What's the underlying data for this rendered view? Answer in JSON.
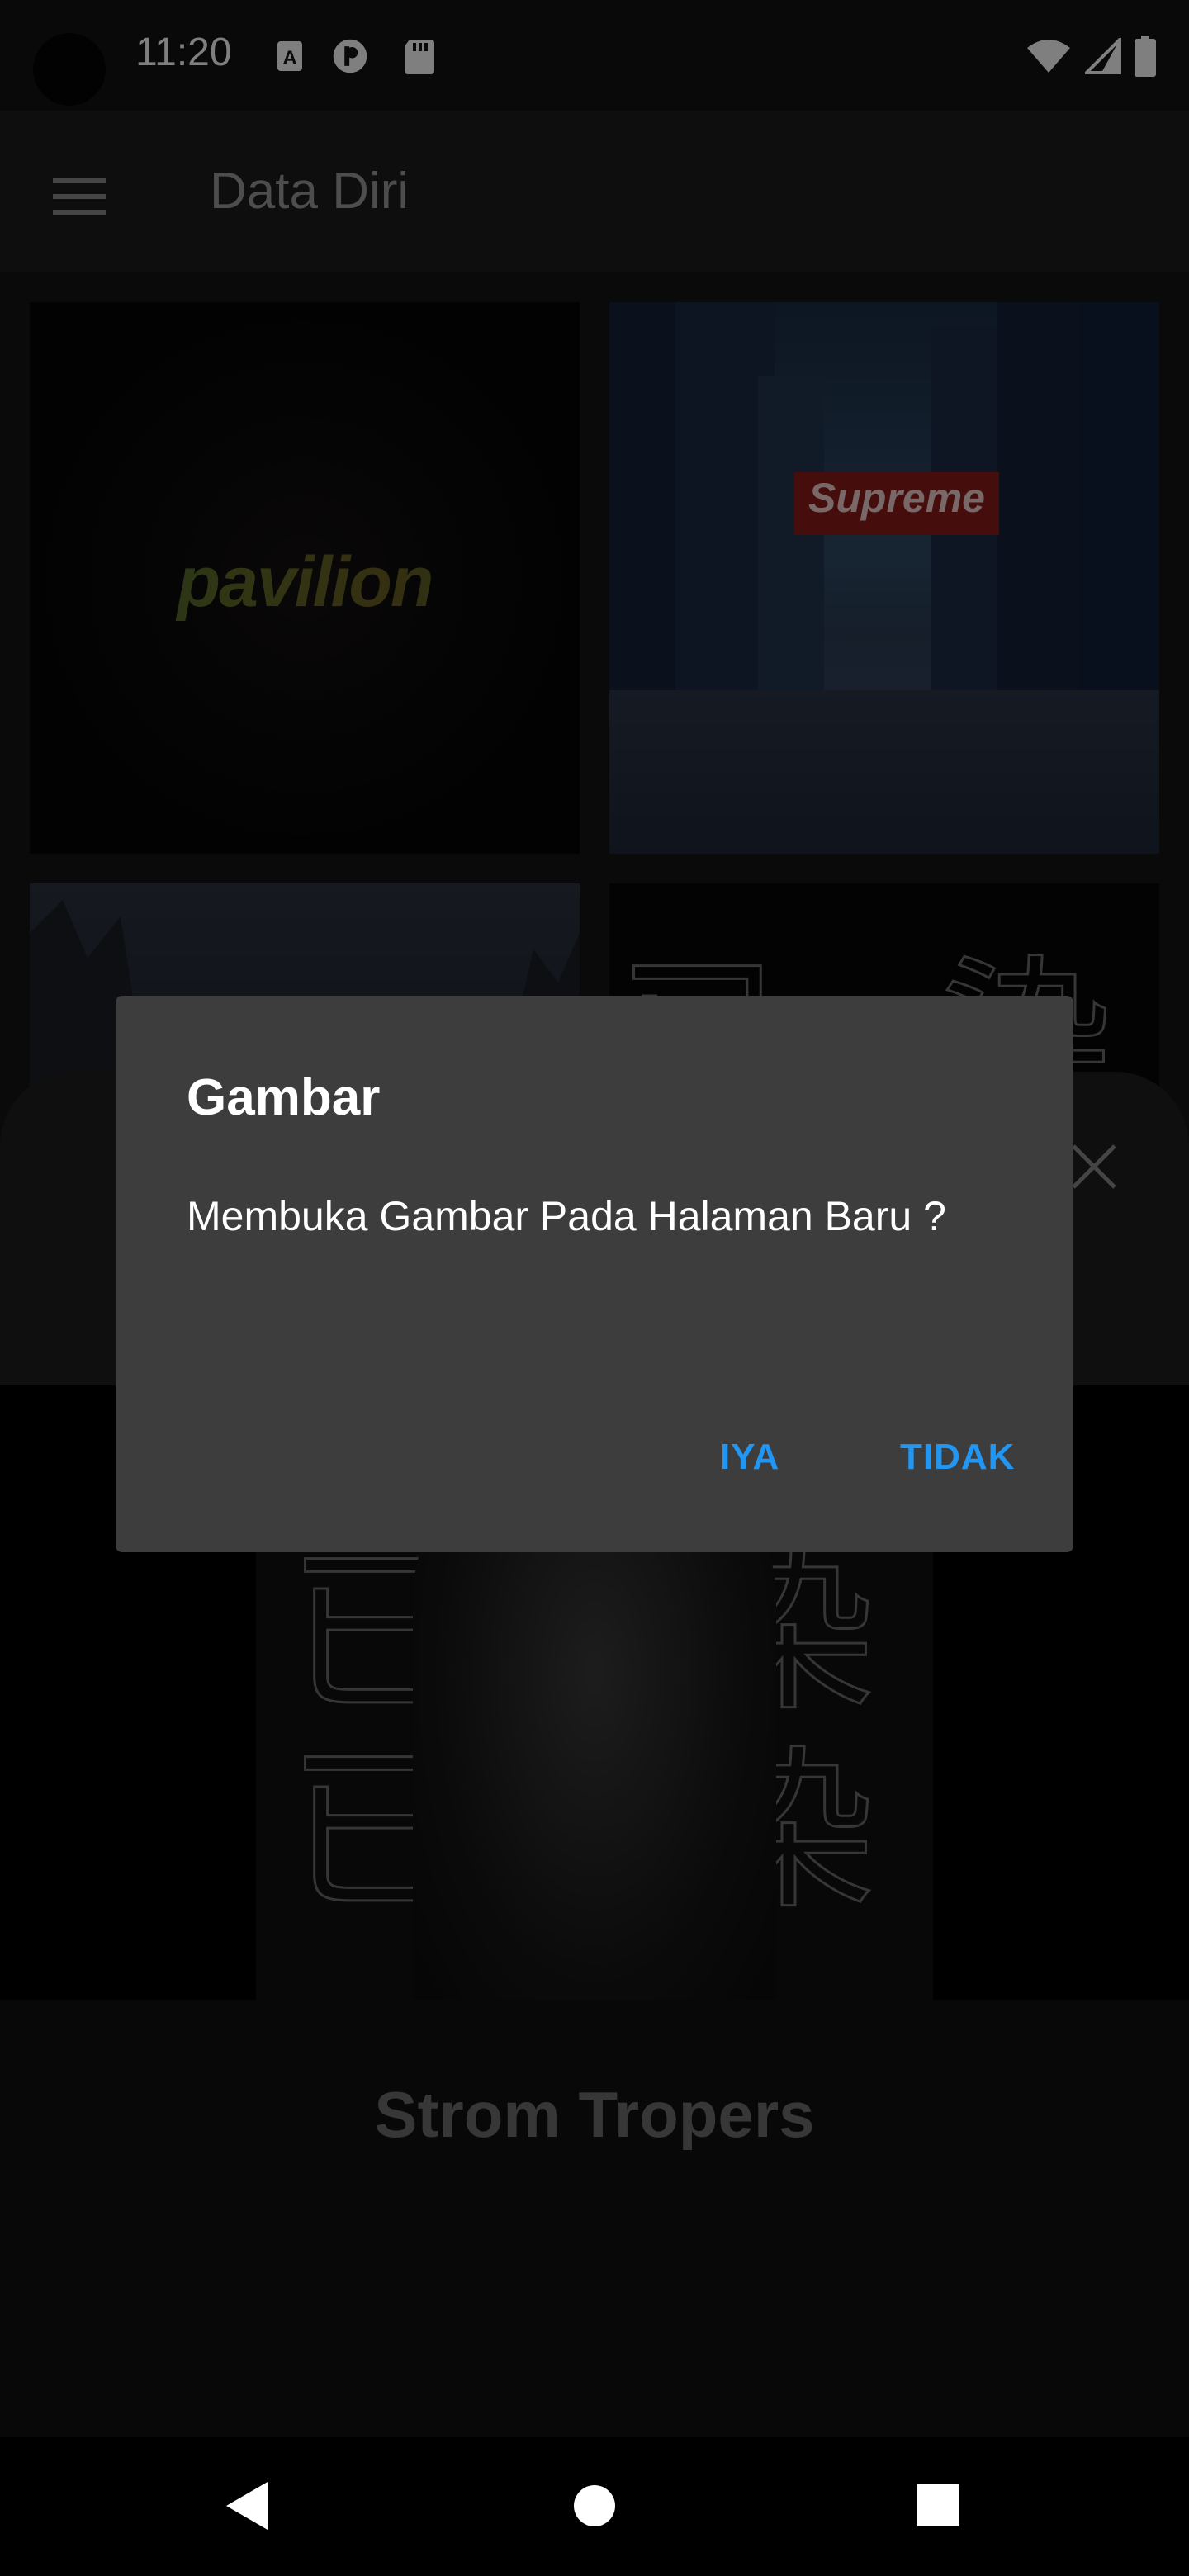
{
  "status_bar": {
    "time": "11:20",
    "icons": [
      "a-notification-icon",
      "pinterest-like-icon",
      "sd-card-icon",
      "wifi-icon",
      "signal-icon",
      "battery-icon"
    ]
  },
  "toolbar": {
    "title": "Data Diri",
    "menu_icon": "hamburger-menu-icon"
  },
  "grid": {
    "tiles": [
      {
        "name": "pavilion-image",
        "text": "pavilion"
      },
      {
        "name": "supreme-city-image",
        "text": "Supreme"
      },
      {
        "name": "mountain-image"
      },
      {
        "name": "kanji-poster-image"
      }
    ]
  },
  "detail": {
    "caption": "Strom Tropers",
    "kanji": [
      "已",
      "染",
      "已",
      "染",
      "已",
      "染"
    ]
  },
  "dialog": {
    "title": "Gambar",
    "message": "Membuka Gambar Pada Halaman Baru ?",
    "positive": "IYA",
    "negative": "TIDAK",
    "accent_color": "#2196F3"
  },
  "nav_bar": {
    "back_icon": "back-triangle-icon",
    "home_icon": "home-circle-icon",
    "recents_icon": "recents-square-icon"
  }
}
